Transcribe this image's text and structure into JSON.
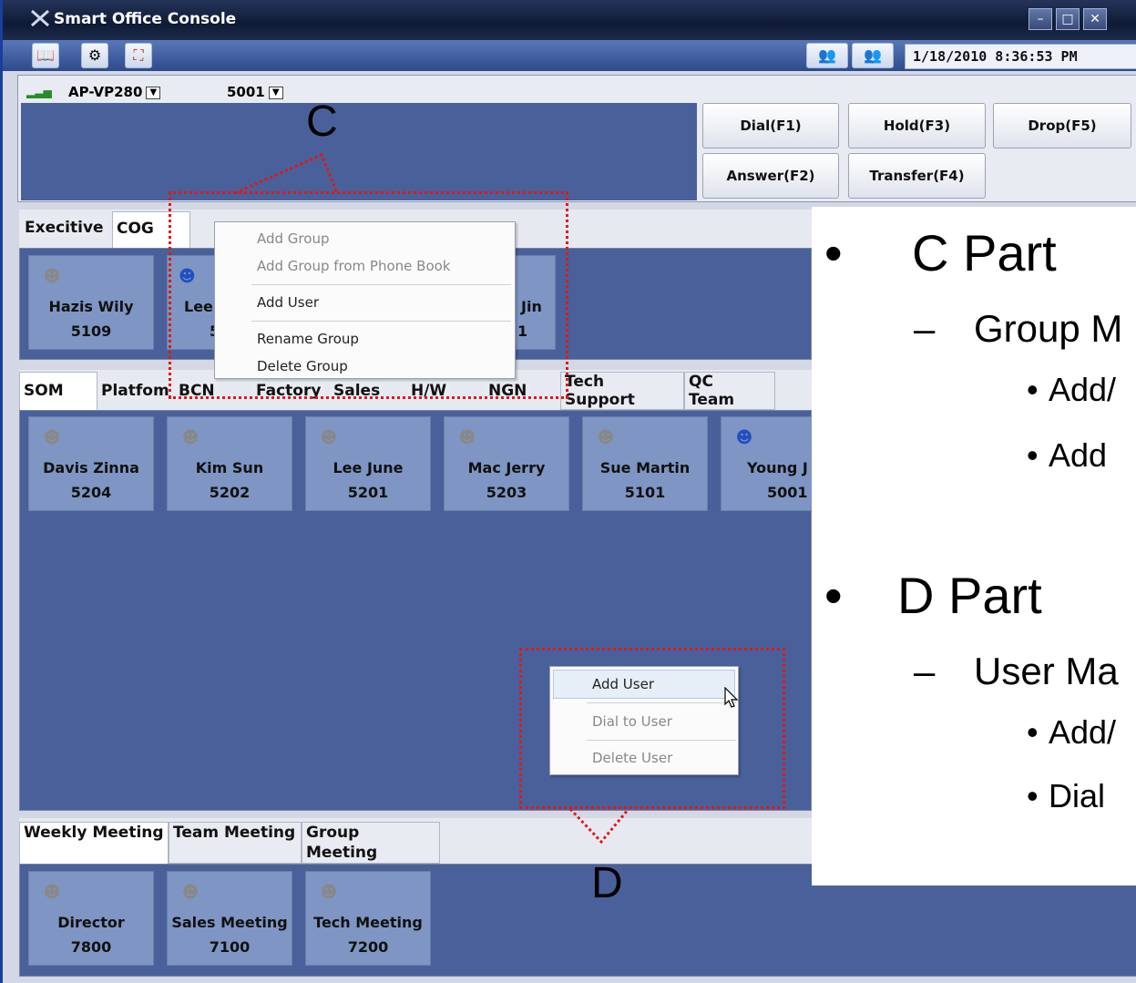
{
  "window": {
    "title": "Smart Office Console"
  },
  "toolbar": {
    "datetime": "1/18/2010 8:36:53 PM"
  },
  "line": {
    "device": "AP-VP280",
    "extension": "5001",
    "buttons": [
      "Dial(F1)",
      "Hold(F3)",
      "Drop(F5)",
      "Answer(F2)",
      "Transfer(F4)"
    ]
  },
  "group_panel": {
    "tabs": [
      "Execitive",
      "COG"
    ],
    "cards": [
      {
        "name": "Hazis Wily",
        "number": "5109"
      },
      {
        "name": "Lee",
        "number": "5"
      },
      {
        "name": "Jin",
        "number": "1"
      }
    ]
  },
  "user_panel": {
    "tabs": [
      "SOM",
      "Platfom",
      "BCN",
      "Factory",
      "Sales",
      "H/W",
      "NGN",
      "Tech\nSupport",
      "QC\nTeam"
    ],
    "cards": [
      {
        "name": "Davis Zinna",
        "number": "5204"
      },
      {
        "name": "Kim Sun",
        "number": "5202"
      },
      {
        "name": "Lee June",
        "number": "5201"
      },
      {
        "name": "Mac Jerry",
        "number": "5203"
      },
      {
        "name": "Sue Martin",
        "number": "5101"
      },
      {
        "name": "Young J",
        "number": "5001"
      }
    ]
  },
  "meeting_panel": {
    "tabs": [
      "Weekly Meeting",
      "Team Meeting",
      "Group Meeting"
    ],
    "cards": [
      {
        "name": "Director",
        "number": "7800"
      },
      {
        "name": "Sales Meeting",
        "number": "7100"
      },
      {
        "name": "Tech Meeting",
        "number": "7200"
      }
    ]
  },
  "group_menu": {
    "items": [
      "Add Group",
      "Add Group from Phone Book",
      "Add User",
      "Rename Group",
      "Delete Group"
    ]
  },
  "user_menu": {
    "items": [
      "Add User",
      "Dial to User",
      "Delete User"
    ]
  },
  "callouts": {
    "c": "C",
    "d": "D"
  },
  "overlay": {
    "c_part": "C Part",
    "c_sub": "Group M",
    "c_b1": "Add/",
    "c_b2": "Add",
    "d_part": "D Part",
    "d_sub": "User Ma",
    "d_b1": "Add/",
    "d_b2": "Dial"
  },
  "colors": {
    "panel_bg": "#4a609a",
    "card_bg": "#7f95c3",
    "callout": "#e01818"
  }
}
